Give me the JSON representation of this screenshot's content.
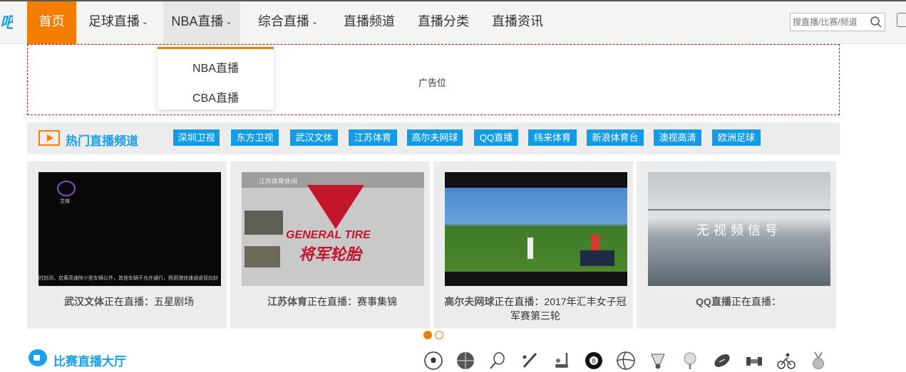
{
  "nav": {
    "items": [
      {
        "label": "首页",
        "caret": false
      },
      {
        "label": "足球直播",
        "caret": true
      },
      {
        "label": "NBA直播",
        "caret": true
      },
      {
        "label": "综合直播",
        "caret": true
      },
      {
        "label": "直播频道",
        "caret": false
      },
      {
        "label": "直播分类",
        "caret": false
      },
      {
        "label": "直播资讯",
        "caret": false
      }
    ],
    "active_index": 0,
    "open_index": 2
  },
  "search": {
    "placeholder": "搜直播/比赛/频道"
  },
  "dropdown": {
    "items": [
      "NBA直播",
      "CBA直播"
    ]
  },
  "ad": {
    "label": "广告位"
  },
  "hot_channels": {
    "title": "热门直播频道",
    "items": [
      "深圳卫视",
      "东方卫视",
      "武汉文体",
      "江苏体育",
      "高尔夫网球",
      "QQ直播",
      "纬来体育",
      "新浪体育台",
      "澳视高清",
      "欧洲足球"
    ]
  },
  "live_cards": [
    {
      "channel": "武汉文体",
      "status": "正在直播：",
      "program": "五星剧场",
      "thumb_logo": "文体",
      "thumb_ticker": "时封闭，启黄高速除小型车辆以外，其他车辆不允许通行，杨泗港快速通道双向封"
    },
    {
      "channel": "江苏体育",
      "status": "正在直播：",
      "program": "赛事集锦",
      "thumb_logo": "江苏体育休闲",
      "thumb_brand": "GENERAL TIRE",
      "thumb_brand_cn": "将军轮胎"
    },
    {
      "channel": "高尔夫网球",
      "status": "正在直播：",
      "program": "2017年汇丰女子冠军赛第三轮"
    },
    {
      "channel": "QQ直播",
      "status": "正在直播：",
      "program": "",
      "thumb_text": "无视频信号"
    }
  ],
  "carousel": {
    "count": 2,
    "active": 0
  },
  "match_hall": {
    "title": "比赛直播大厅"
  },
  "sport_icons": [
    "soccer-icon",
    "basketball-icon",
    "tennis-icon",
    "baseball-icon",
    "hockey-icon",
    "billiards-icon",
    "volleyball-icon",
    "badminton-icon",
    "golf-icon",
    "football-icon",
    "racing-icon",
    "cycling-icon",
    "medal-icon"
  ],
  "colors": {
    "accent": "#f27d00",
    "brand_blue": "#19a0e6",
    "tag_blue": "#129be6",
    "ad_border": "#c0101a"
  }
}
